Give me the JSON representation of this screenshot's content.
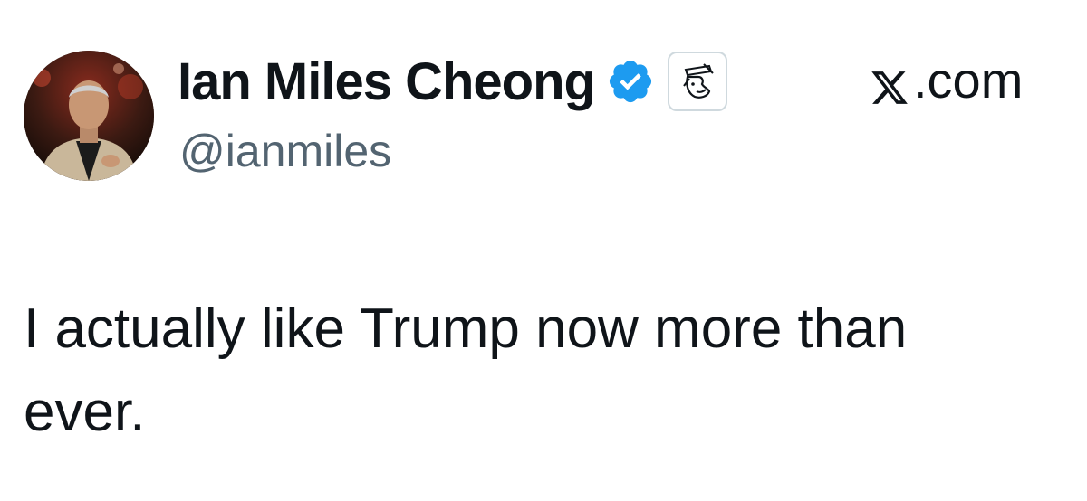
{
  "tweet": {
    "author": {
      "display_name": "Ian Miles Cheong",
      "handle": "@ianmiles",
      "verified_icon": "verified-badge-icon",
      "affiliate_icon": "affiliate-badge-icon",
      "avatar": "profile-photo"
    },
    "source": {
      "label": ".com",
      "icon": "x-logo-icon"
    },
    "text": "I actually like Trump now more than ever."
  },
  "colors": {
    "text_primary": "#0f1419",
    "text_secondary": "#536471",
    "verified_blue": "#1d9bf0",
    "badge_border": "#cfd9de"
  }
}
